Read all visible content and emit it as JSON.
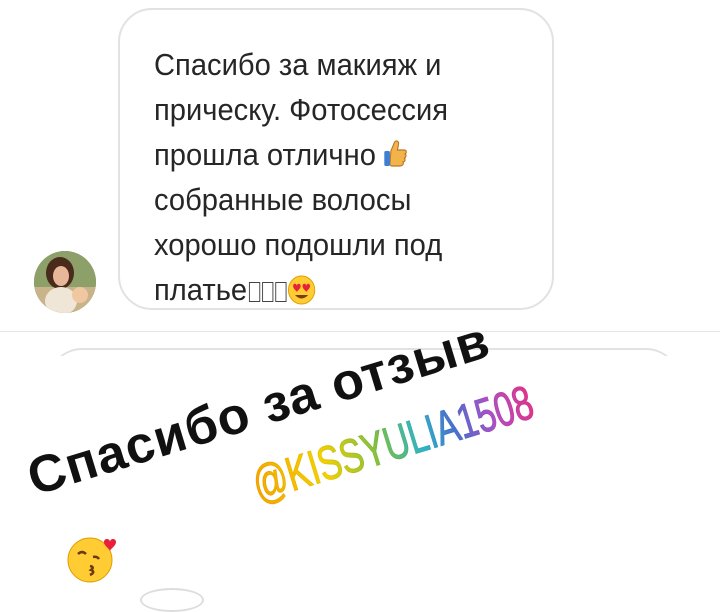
{
  "message": {
    "lines": [
      "Спасибо за макияж и",
      "прическу. Фотосессия",
      "прошла отлично",
      "собранные волосы",
      "хорошо подошли под",
      "платье"
    ],
    "thumb_emoji": "thumbs-up-icon",
    "heart_eyes_emoji": "heart-eyes-icon"
  },
  "story_overlay": {
    "thanks_text": "Спасибо  за  отзыв",
    "mention": "@KISSYULIA1508",
    "kiss_emoji": "kissing-heart-icon",
    "mention_gradient": [
      "#f7a600",
      "#f4d100",
      "#7bc043",
      "#2cb5c8",
      "#4a6fd0",
      "#b14fc5",
      "#e2338c"
    ]
  }
}
